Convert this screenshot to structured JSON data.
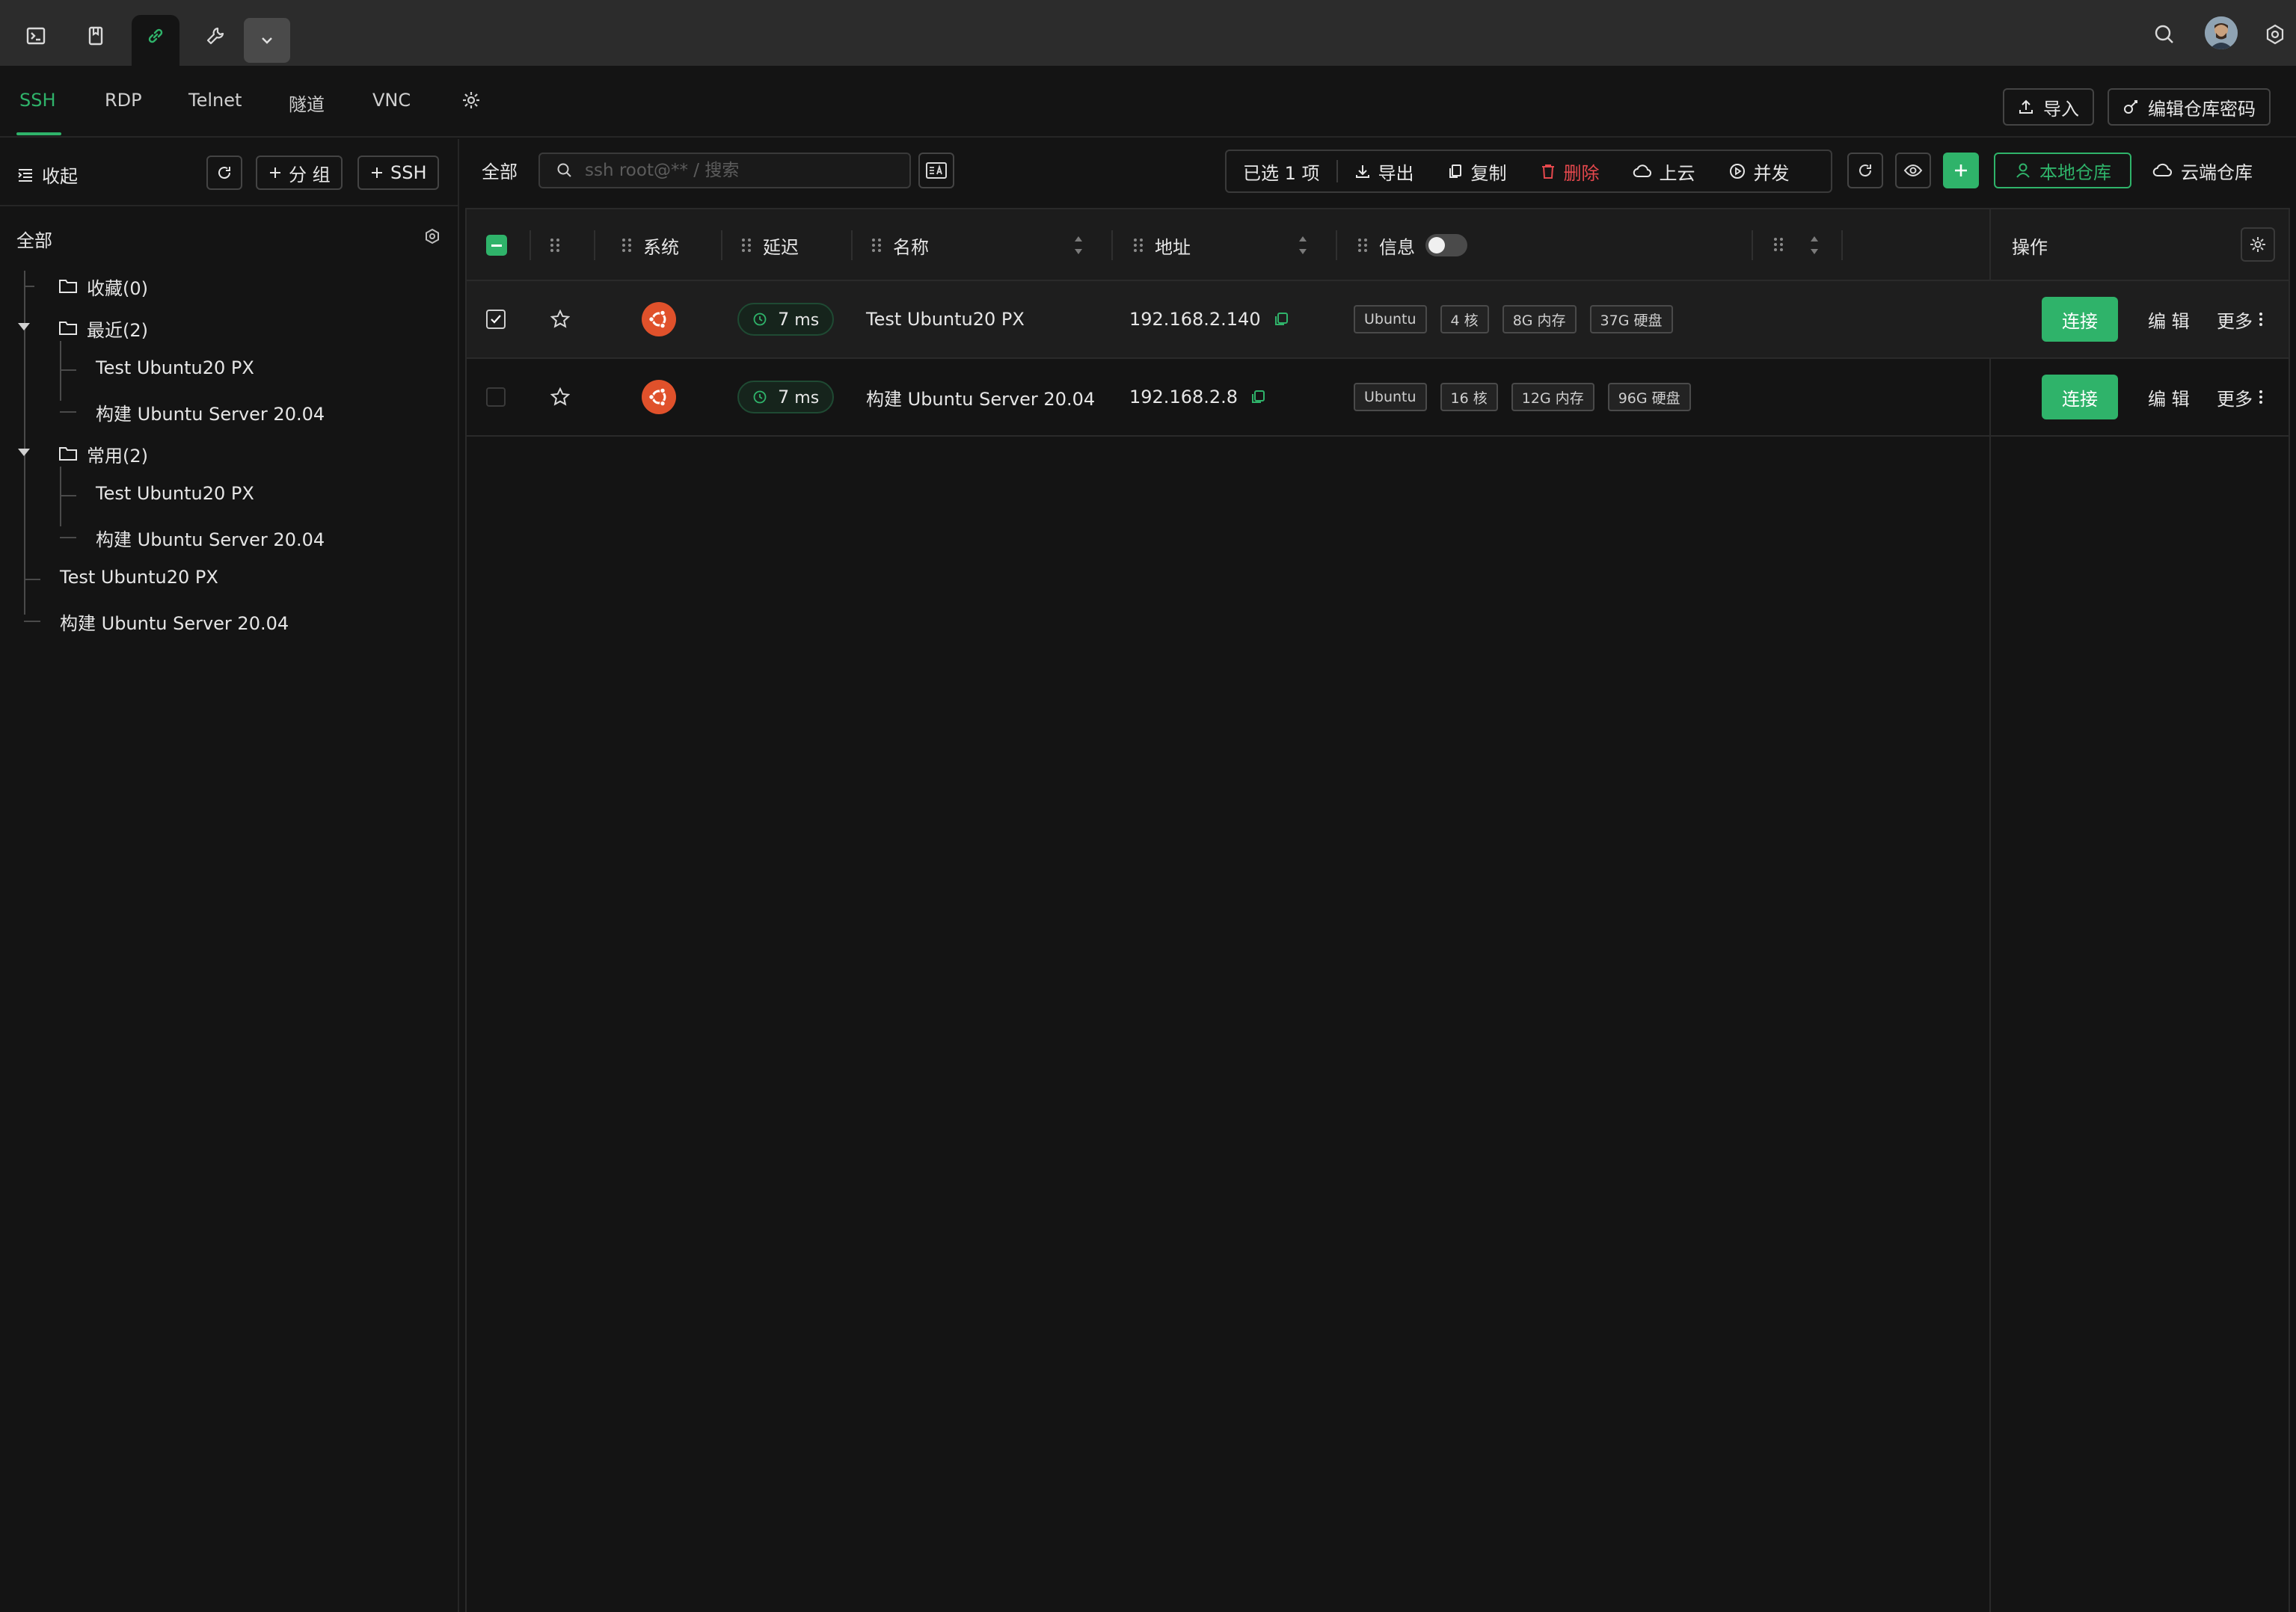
{
  "topbar": {
    "icons": [
      "terminal-icon",
      "bookmark-icon",
      "link-icon",
      "wrench-icon",
      "chevron-down-icon"
    ],
    "right_icons": [
      "search-icon",
      "avatar",
      "settings-hex-icon"
    ]
  },
  "protocol_tabs": {
    "items": [
      "SSH",
      "RDP",
      "Telnet",
      "隧道",
      "VNC"
    ],
    "active": "SSH",
    "import_label": "导入",
    "edit_repo_password_label": "编辑仓库密码"
  },
  "sidebar": {
    "collapse_label": "收起",
    "add_group_label": "分 组",
    "add_ssh_label": "SSH",
    "root_label": "全部",
    "favorites_label": "收藏(0)",
    "recent_label": "最近(2)",
    "recent_items": [
      "Test Ubuntu20 PX",
      "构建 Ubuntu Server 20.04"
    ],
    "common_label": "常用(2)",
    "common_items": [
      "Test Ubuntu20 PX",
      "构建 Ubuntu Server 20.04"
    ],
    "root_items": [
      "Test Ubuntu20 PX",
      "构建 Ubuntu Server 20.04"
    ]
  },
  "toolbar": {
    "scope_label": "全部",
    "search_placeholder": "ssh root@** / 搜索",
    "selected_label": "已选 1 项",
    "export_label": "导出",
    "copy_label": "复制",
    "delete_label": "删除",
    "upload_cloud_label": "上云",
    "concurrent_label": "并发",
    "local_repo_label": "本地仓库",
    "cloud_repo_label": "云端仓库"
  },
  "table": {
    "headers": {
      "system": "系统",
      "latency": "延迟",
      "name": "名称",
      "address": "地址",
      "info": "信息",
      "operations": "操作"
    },
    "rows": [
      {
        "selected": true,
        "latency": "7",
        "latency_unit": "ms",
        "name": "Test Ubuntu20 PX",
        "address": "192.168.2.140",
        "tags": [
          "Ubuntu",
          "4 核",
          "8G 内存",
          "37G 硬盘"
        ],
        "connect_label": "连接",
        "edit_label": "编 辑",
        "more_label": "更多"
      },
      {
        "selected": false,
        "latency": "7",
        "latency_unit": "ms",
        "name": "构建 Ubuntu Server 20.04",
        "address": "192.168.2.8",
        "tags": [
          "Ubuntu",
          "16 核",
          "12G 内存",
          "96G 硬盘"
        ],
        "connect_label": "连接",
        "edit_label": "编 辑",
        "more_label": "更多"
      }
    ]
  },
  "colors": {
    "accent": "#2fb36a",
    "danger": "#e5484d",
    "background": "#141414",
    "topbar": "#2c2c2c",
    "ubuntu": "#e0512b"
  }
}
